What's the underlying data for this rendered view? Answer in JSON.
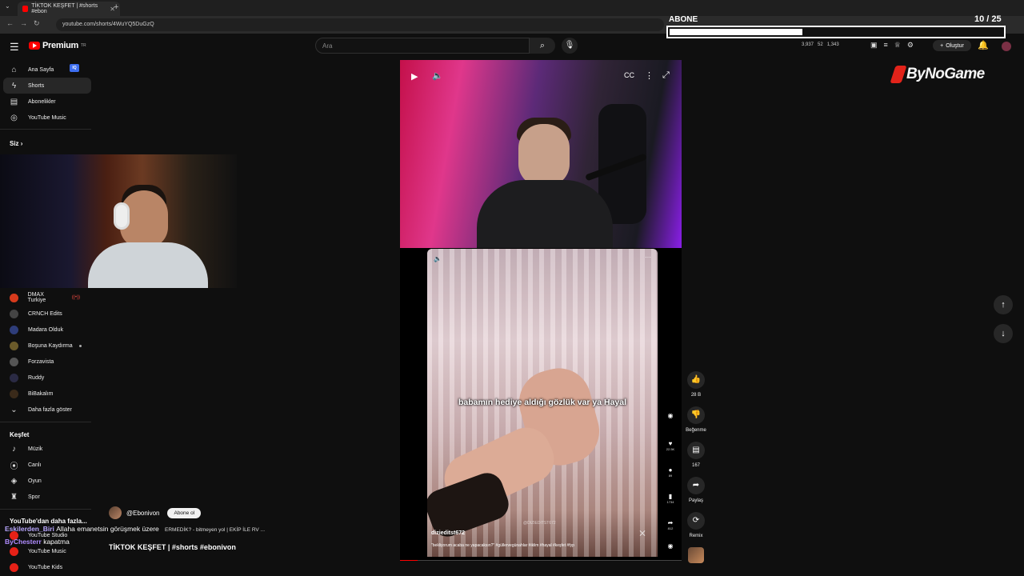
{
  "browser": {
    "tab_title": "TİKTOK KEŞFET | #shorts #ebon",
    "url": "youtube.com/shorts/4WuYQ5DuGzQ"
  },
  "goal": {
    "title": "ABONE",
    "count": "10 / 25",
    "progress": 0.4
  },
  "header": {
    "logo": "Premium",
    "logo_sup": "TR",
    "search_placeholder": "Ara",
    "stats": [
      "3,937",
      "52",
      "1,343"
    ],
    "create_label": "Oluştur"
  },
  "sidebar": {
    "main": [
      {
        "label": "Ana Sayfa",
        "icon": "home-icon"
      },
      {
        "label": "Shorts",
        "icon": "shorts-icon"
      },
      {
        "label": "Abonelikler",
        "icon": "subscriptions-icon"
      },
      {
        "label": "YouTube Music",
        "icon": "music-icon"
      }
    ],
    "siz_label": "Siz",
    "subs": [
      {
        "label": "DMAX Turkiye",
        "color": "#d63a1c"
      },
      {
        "label": "CRNCH Edits",
        "color": "#444444"
      },
      {
        "label": "Madara Olduk",
        "color": "#2e3d7a"
      },
      {
        "label": "Boşuna Kaydırma",
        "color": "#6a5a2a"
      },
      {
        "label": "Forzavista",
        "color": "#555555"
      },
      {
        "label": "Ruddy",
        "color": "#2a2a44"
      },
      {
        "label": "BiBakalım",
        "color": "#3a2a1a"
      }
    ],
    "more_label": "Daha fazla göster",
    "explore_title": "Keşfet",
    "explore": [
      {
        "label": "Müzik",
        "icon": "music-note-icon"
      },
      {
        "label": "Canlı",
        "icon": "live-icon"
      },
      {
        "label": "Oyun",
        "icon": "gamepad-icon"
      },
      {
        "label": "Spor",
        "icon": "trophy-icon"
      }
    ],
    "more_yt_title": "YouTube'dan daha fazla...",
    "more_yt": [
      {
        "label": "YouTube Studio"
      },
      {
        "label": "YouTube Music"
      },
      {
        "label": "YouTube Kids"
      }
    ]
  },
  "video": {
    "subtitle": "babamın hediye aldığı gözlük var ya Hayal",
    "username": "dizieditst672",
    "caption": "\"bekliyorum acaba ne yapacaksın?\" #güllervegünahlar #iklim #hayal #keşfet #fyp",
    "watermark": "@DIZIEDITST672",
    "rail_counts": [
      "22.5K",
      "89",
      "1734",
      "812"
    ]
  },
  "actions": {
    "like_count": "28 B",
    "dislike_label": "Beğenme",
    "comment_count": "167",
    "share_label": "Paylaş",
    "remix_label": "Remix"
  },
  "channel": {
    "name": "@Ebonivon",
    "subscribe": "Abone ol",
    "short_title": "TİKTOK KEŞFET | #shorts #ebonivon",
    "line": "ERMEDİK? - bitmeyen yol | EKİP İLE RV ..."
  },
  "chat": [
    {
      "user": "Eskilerden_Biri",
      "message": "Allaha emanetsin görüşmek üzere"
    },
    {
      "user": "ByChesterr",
      "message": "kapatma"
    }
  ],
  "brand": {
    "watermark": "ByNoGame"
  }
}
